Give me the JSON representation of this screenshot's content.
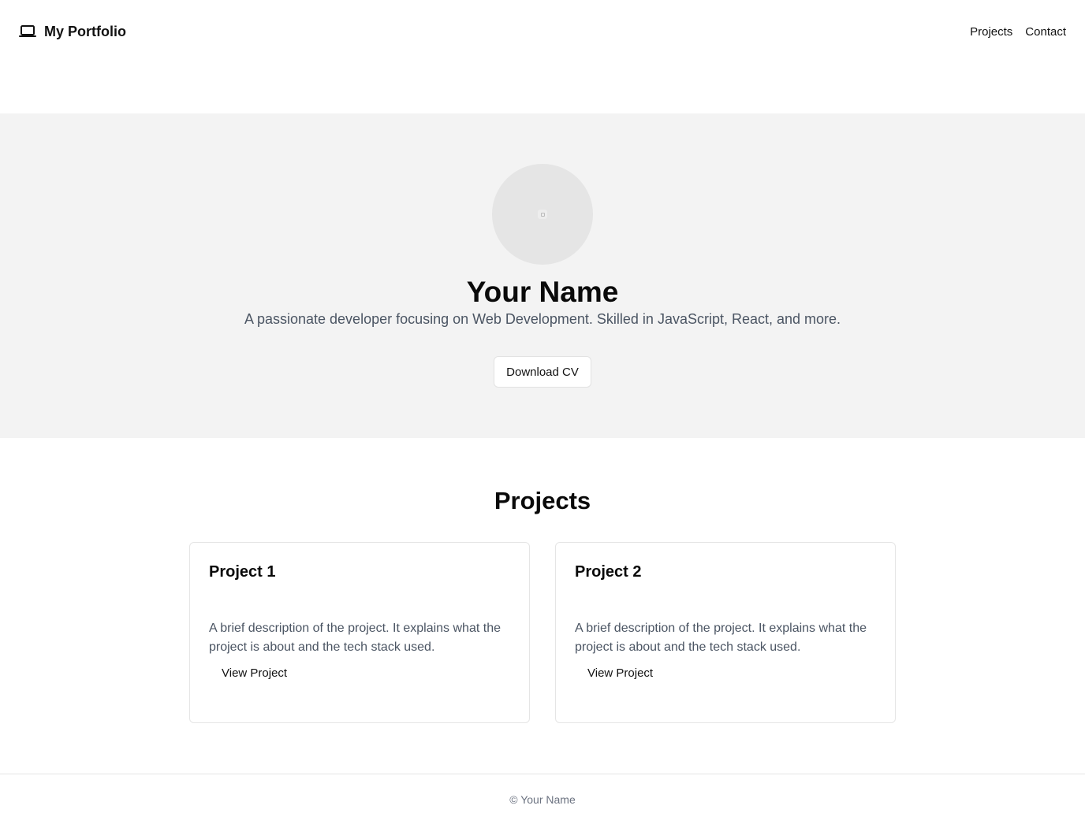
{
  "header": {
    "brand_title": "My Portfolio",
    "brand_icon": "laptop-icon",
    "nav": [
      "Projects",
      "Contact"
    ]
  },
  "hero": {
    "avatar_icon": "image-placeholder-icon",
    "name": "Your Name",
    "tagline": "A passionate developer focusing on Web Development. Skilled in JavaScript, React, and more.",
    "cv_button": "Download CV"
  },
  "projects": {
    "title": "Projects",
    "items": [
      {
        "title": "Project 1",
        "description": "A brief description of the project. It explains what the project is about and the tech stack used.",
        "link": "View Project"
      },
      {
        "title": "Project 2",
        "description": "A brief description of the project. It explains what the project is about and the tech stack used.",
        "link": "View Project"
      }
    ]
  },
  "footer": {
    "text": "© Your Name"
  },
  "colors": {
    "hero_background": "#f3f3f3",
    "muted_text": "#4b5563",
    "border": "#e5e5e5"
  }
}
